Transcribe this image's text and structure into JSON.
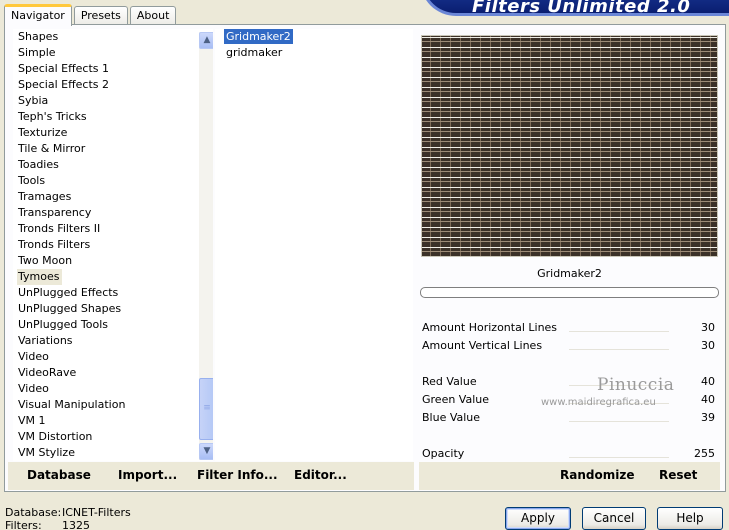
{
  "tabs": [
    "Navigator",
    "Presets",
    "About"
  ],
  "app_title": "Filters Unlimited 2.0",
  "categories": [
    "Shapes",
    "Simple",
    "Special Effects 1",
    "Special Effects 2",
    "Sybia",
    "Teph's Tricks",
    "Texturize",
    "Tile & Mirror",
    "Toadies",
    "Tools",
    "Tramages",
    "Transparency",
    "Tronds Filters II",
    "Tronds Filters",
    "Two Moon",
    "Tymoes",
    "UnPlugged Effects",
    "UnPlugged Shapes",
    "UnPlugged Tools",
    "Variations",
    "Video",
    "VideoRave",
    "Video",
    "Visual Manipulation",
    "VM 1",
    "VM Distortion",
    "VM Stylize"
  ],
  "selected_category": "Tymoes",
  "filters": [
    "Gridmaker2",
    "gridmaker"
  ],
  "selected_filter": "Gridmaker2",
  "preview_label": "Gridmaker2",
  "params": [
    {
      "name": "Amount Horizontal Lines",
      "value": "30"
    },
    {
      "name": "Amount Vertical Lines",
      "value": "30"
    },
    {
      "name": "Red Value",
      "value": "40"
    },
    {
      "name": "Green Value",
      "value": "40"
    },
    {
      "name": "Blue Value",
      "value": "39"
    },
    {
      "name": "Opacity",
      "value": "255"
    }
  ],
  "watermark": {
    "name": "Pinuccia",
    "url": "www.maidiregrafica.eu"
  },
  "left_buttons": {
    "database": "Database",
    "import": "Import...",
    "filter_info": "Filter Info...",
    "editor": "Editor..."
  },
  "right_buttons": {
    "randomize": "Randomize",
    "reset": "Reset"
  },
  "status": {
    "database_label": "Database:",
    "database_value": "ICNET-Filters",
    "filters_label": "Filters:",
    "filters_value": "1325"
  },
  "dialog_buttons": {
    "apply": "Apply",
    "cancel": "Cancel",
    "help": "Help"
  }
}
